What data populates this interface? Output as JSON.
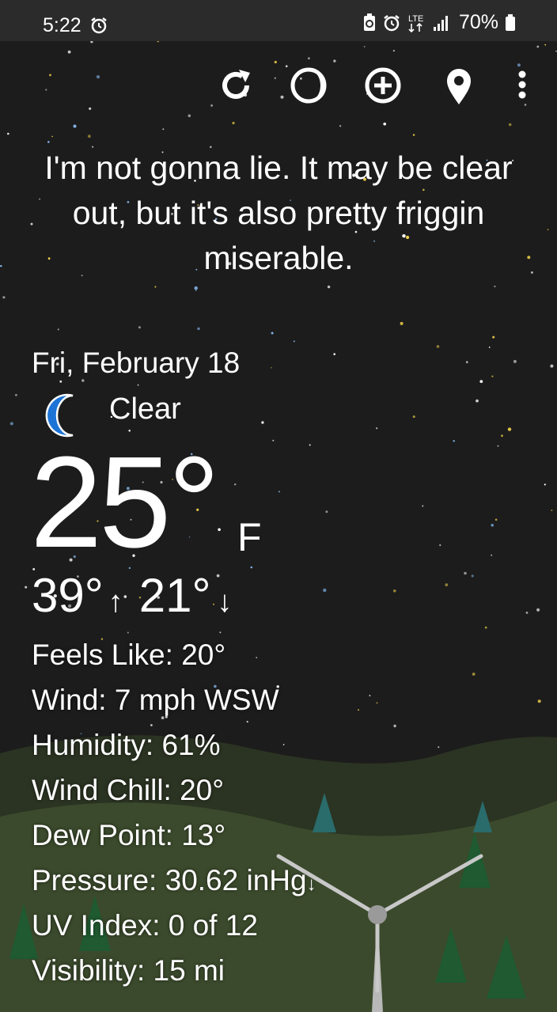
{
  "status_bar": {
    "time": "5:22",
    "battery": "70%",
    "network": "LTE"
  },
  "toolbar": {
    "icons": [
      "refresh-icon",
      "moon-phase-icon",
      "add-location-icon",
      "location-pin-icon",
      "more-vert-icon"
    ]
  },
  "headline": "I'm not gonna lie. It may be clear out, but it's also pretty friggin miserable.",
  "date": "Fri, February 18",
  "condition": {
    "icon": "crescent-moon-icon",
    "text": "Clear"
  },
  "temperature": {
    "current": "25°",
    "unit": "F",
    "high": "39°",
    "low": "21°"
  },
  "details": {
    "feels_like": "Feels Like:  20°",
    "wind": "Wind:  7 mph WSW",
    "humidity": "Humidity:  61%",
    "wind_chill": "Wind Chill:  20°",
    "dew_point": "Dew Point:  13°",
    "pressure": "Pressure:  30.62 inHg",
    "uv_index": "UV Index:  0 of 12",
    "visibility": "Visibility:  15 mi"
  },
  "colors": {
    "sky": "#1c1c1c",
    "status_bar": "#2b2b2b",
    "moon": "#1e73d6",
    "star_yellow": "#f2d24a",
    "star_blue": "#8fc6ff",
    "hills": "#3a4a2e",
    "trees": "#1f5a30"
  }
}
